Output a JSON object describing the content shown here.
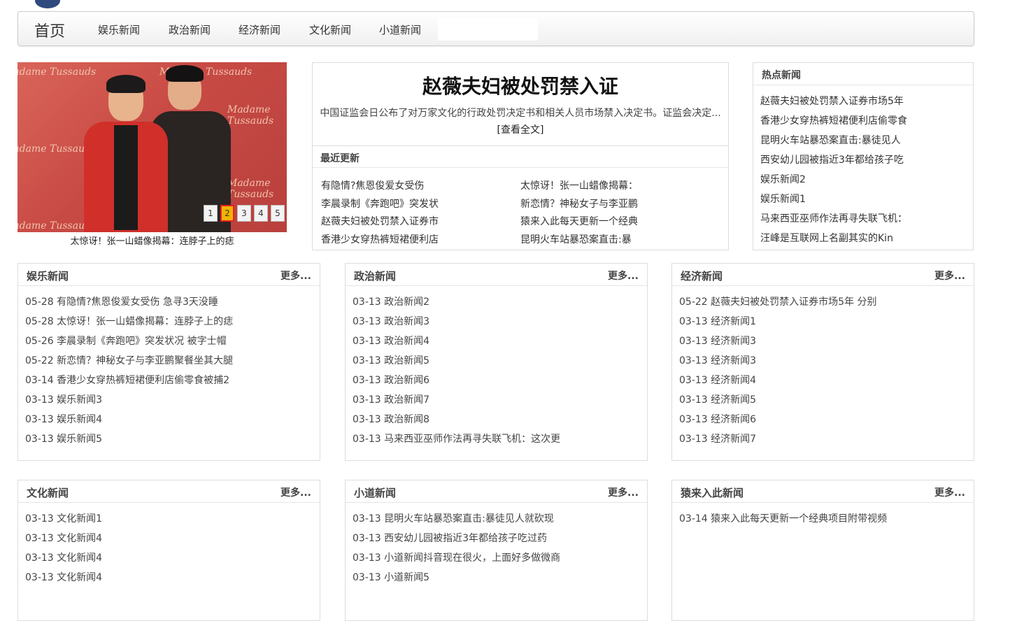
{
  "nav": {
    "home": "首页",
    "items": [
      "娱乐新闻",
      "政治新闻",
      "经济新闻",
      "文化新闻",
      "小道新闻"
    ]
  },
  "slider": {
    "watermark": "Madame Tussauds",
    "dots": [
      "1",
      "2",
      "3",
      "4",
      "5"
    ],
    "active_dot": "2",
    "caption": "太惊讶！张一山蜡像揭幕：连脖子上的痣"
  },
  "headline": {
    "title": "赵薇夫妇被处罚禁入证",
    "summary": "中国证监会日公布了对万家文化的行政处罚决定书和相关人员市场禁入决定书。证监会决定...",
    "more_link": "[查看全文]",
    "recent_title": "最近更新",
    "recent_left": [
      "有隐情?焦恩俊爱女受伤",
      "李晨录制《奔跑吧》突发状",
      "赵薇夫妇被处罚禁入证券市",
      "香港少女穿热裤短裙便利店"
    ],
    "recent_right": [
      "太惊讶！张一山蜡像揭幕：",
      "新恋情？神秘女子与李亚鹏",
      "猿来入此每天更新一个经典",
      "昆明火车站暴恐案直击:暴"
    ]
  },
  "hot": {
    "title": "热点新闻",
    "items": [
      "赵薇夫妇被处罚禁入证券市场5年",
      "香港少女穿热裤短裙便利店偷零食",
      "昆明火车站暴恐案直击:暴徒见人",
      "西安幼儿园被指近3年都给孩子吃",
      "娱乐新闻2",
      "娱乐新闻1",
      "马来西亚巫师作法再寻失联飞机：",
      "汪峰是互联网上名副其实的Kin"
    ]
  },
  "panels": [
    {
      "title": "娱乐新闻",
      "more": "更多...",
      "items": [
        "05-28 有隐情?焦恩俊爱女受伤 急寻3天没睡",
        "05-28 太惊讶！张一山蜡像揭幕：连脖子上的痣",
        "05-26 李晨录制《奔跑吧》突发状况 被字士帽",
        "05-22 新恋情？神秘女子与李亚鹏聚餐坐其大腿",
        "03-14 香港少女穿热裤短裙便利店偷零食被捕2",
        "03-13 娱乐新闻3",
        "03-13 娱乐新闻4",
        "03-13 娱乐新闻5"
      ]
    },
    {
      "title": "政治新闻",
      "more": "更多...",
      "items": [
        "03-13 政治新闻2",
        "03-13 政治新闻3",
        "03-13 政治新闻4",
        "03-13 政治新闻5",
        "03-13 政治新闻6",
        "03-13 政治新闻7",
        "03-13 政治新闻8",
        "03-13 马来西亚巫师作法再寻失联飞机：这次更"
      ]
    },
    {
      "title": "经济新闻",
      "more": "更多...",
      "items": [
        "05-22 赵薇夫妇被处罚禁入证券市场5年 分别",
        "03-13 经济新闻1",
        "03-13 经济新闻3",
        "03-13 经济新闻3",
        "03-13 经济新闻4",
        "03-13 经济新闻5",
        "03-13 经济新闻6",
        "03-13 经济新闻7"
      ]
    },
    {
      "title": "文化新闻",
      "more": "更多...",
      "items": [
        "03-13 文化新闻1",
        "03-13 文化新闻4",
        "03-13 文化新闻4",
        "03-13 文化新闻4"
      ]
    },
    {
      "title": "小道新闻",
      "more": "更多...",
      "items": [
        "03-13 昆明火车站暴恐案直击:暴徒见人就砍现",
        "03-13 西安幼儿园被指近3年都给孩子吃过药",
        "03-13 小道新闻抖音现在很火，上面好多做微商",
        "03-13 小道新闻5"
      ]
    },
    {
      "title": "猿来入此新闻",
      "more": "更多...",
      "items": [
        "03-14 猿来入此每天更新一个经典项目附带视频"
      ]
    }
  ]
}
